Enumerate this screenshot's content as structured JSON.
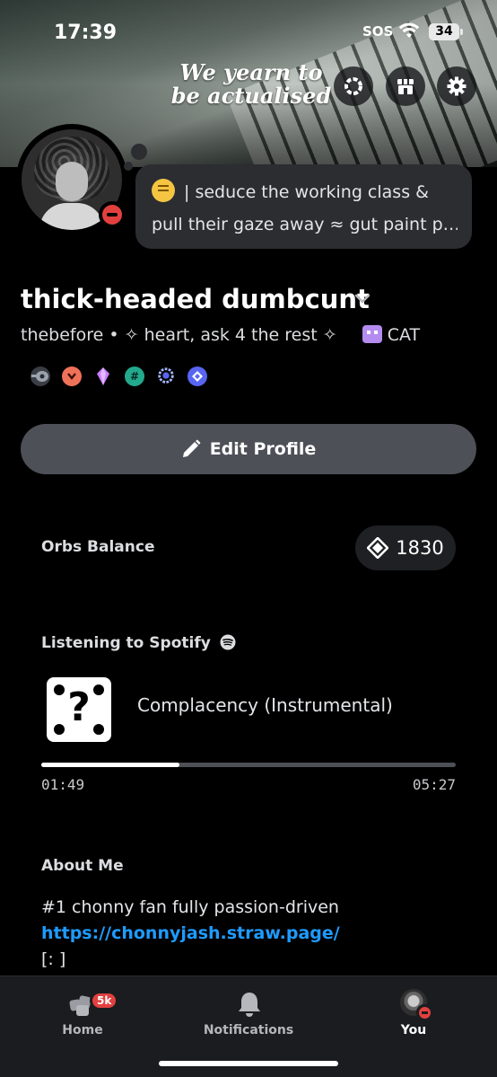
{
  "status_bar": {
    "time": "17:39",
    "sos": "SOS",
    "battery": "34"
  },
  "banner": {
    "text_line1": "We yearn to",
    "text_line2": "be actualised"
  },
  "top_buttons": [
    "nitro-icon",
    "shop-icon",
    "gear-icon"
  ],
  "custom_status": {
    "emoji": "relieved-face-emoji",
    "line1": "| seduce the working class &",
    "line2": "pull their gaze away ≈ gut paint p…"
  },
  "profile": {
    "display_name": "thick-headed dumbcunt",
    "username": "thebefore",
    "separator": "•",
    "pronouns": "✧ heart, ask 4 the rest ✧",
    "tag": "CAT"
  },
  "badges": [
    "quest-badge",
    "hypesquad-badge",
    "nitro-gem-badge",
    "hash-badge",
    "laurel-badge",
    "orb-badge"
  ],
  "edit_profile": {
    "label": "Edit Profile"
  },
  "orbs": {
    "title": "Orbs Balance",
    "balance": "1830"
  },
  "spotify": {
    "title": "Listening to Spotify",
    "track": "Complacency (Instrumental)",
    "elapsed": "01:49",
    "duration": "05:27",
    "progress": 0.333
  },
  "about": {
    "title": "About Me",
    "line1": "#1 chonny fan fully passion-driven",
    "link": "https://chonnyjash.straw.page/",
    "line3": "[: ]"
  },
  "tabbar": {
    "home": "Home",
    "home_badge": "5k",
    "notifications": "Notifications",
    "you": "You"
  },
  "colors": {
    "accent_link": "#1e9bff",
    "dnd_red": "#e2403f",
    "card_bg": "#2b2d31",
    "button_bg": "#4e5058"
  }
}
